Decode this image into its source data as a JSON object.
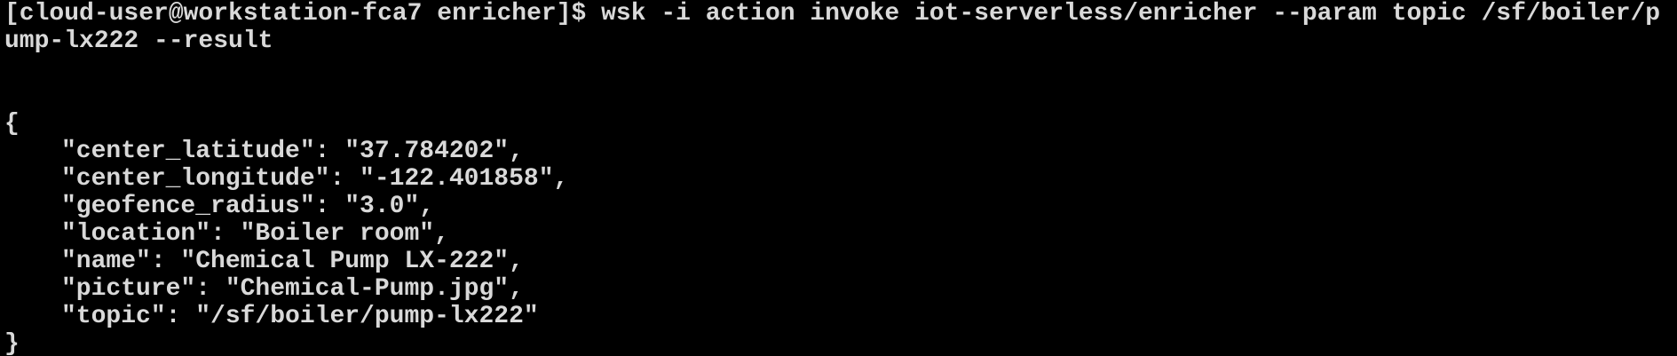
{
  "terminal": {
    "command_line_1": "[cloud-user@workstation-fca7 enricher]$ wsk -i action invoke iot-serverless/enricher --param topic /sf/boiler/p",
    "command_line_2": "ump-lx222 --result",
    "open_brace": "{",
    "json_lines": [
      "\"center_latitude\": \"37.784202\",",
      "\"center_longitude\": \"-122.401858\",",
      "\"geofence_radius\": \"3.0\",",
      "\"location\": \"Boiler room\",",
      "\"name\": \"Chemical Pump LX-222\",",
      "\"picture\": \"Chemical-Pump.jpg\",",
      "\"topic\": \"/sf/boiler/pump-lx222\""
    ],
    "close_brace": "}",
    "colors": {
      "background": "#000000",
      "text": "#d9d9d9"
    }
  }
}
